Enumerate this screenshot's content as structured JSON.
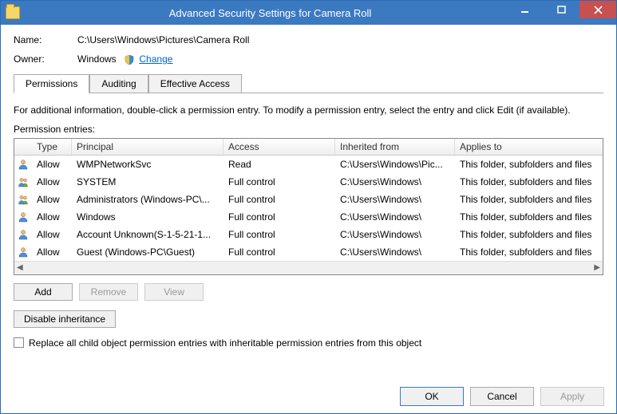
{
  "window": {
    "title": "Advanced Security Settings for Camera Roll"
  },
  "fields": {
    "name_label": "Name:",
    "name_value": "C:\\Users\\Windows\\Pictures\\Camera Roll",
    "owner_label": "Owner:",
    "owner_value": "Windows",
    "change_link": "Change"
  },
  "tabs": {
    "permissions": "Permissions",
    "auditing": "Auditing",
    "effective": "Effective Access"
  },
  "info_text": "For additional information, double-click a permission entry. To modify a permission entry, select the entry and click Edit (if available).",
  "list_label": "Permission entries:",
  "columns": {
    "type": "Type",
    "principal": "Principal",
    "access": "Access",
    "inherited": "Inherited from",
    "applies": "Applies to"
  },
  "entries": [
    {
      "type": "Allow",
      "principal": "WMPNetworkSvc",
      "access": "Read",
      "inherited": "C:\\Users\\Windows\\Pic...",
      "applies": "This folder, subfolders and files"
    },
    {
      "type": "Allow",
      "principal": "SYSTEM",
      "access": "Full control",
      "inherited": "C:\\Users\\Windows\\",
      "applies": "This folder, subfolders and files"
    },
    {
      "type": "Allow",
      "principal": "Administrators (Windows-PC\\...",
      "access": "Full control",
      "inherited": "C:\\Users\\Windows\\",
      "applies": "This folder, subfolders and files"
    },
    {
      "type": "Allow",
      "principal": "Windows",
      "access": "Full control",
      "inherited": "C:\\Users\\Windows\\",
      "applies": "This folder, subfolders and files"
    },
    {
      "type": "Allow",
      "principal": "Account Unknown(S-1-5-21-1...",
      "access": "Full control",
      "inherited": "C:\\Users\\Windows\\",
      "applies": "This folder, subfolders and files"
    },
    {
      "type": "Allow",
      "principal": "Guest (Windows-PC\\Guest)",
      "access": "Full control",
      "inherited": "C:\\Users\\Windows\\",
      "applies": "This folder, subfolders and files"
    }
  ],
  "buttons": {
    "add": "Add",
    "remove": "Remove",
    "view": "View",
    "disable_inheritance": "Disable inheritance",
    "ok": "OK",
    "cancel": "Cancel",
    "apply": "Apply"
  },
  "checkbox_label": "Replace all child object permission entries with inheritable permission entries from this object"
}
